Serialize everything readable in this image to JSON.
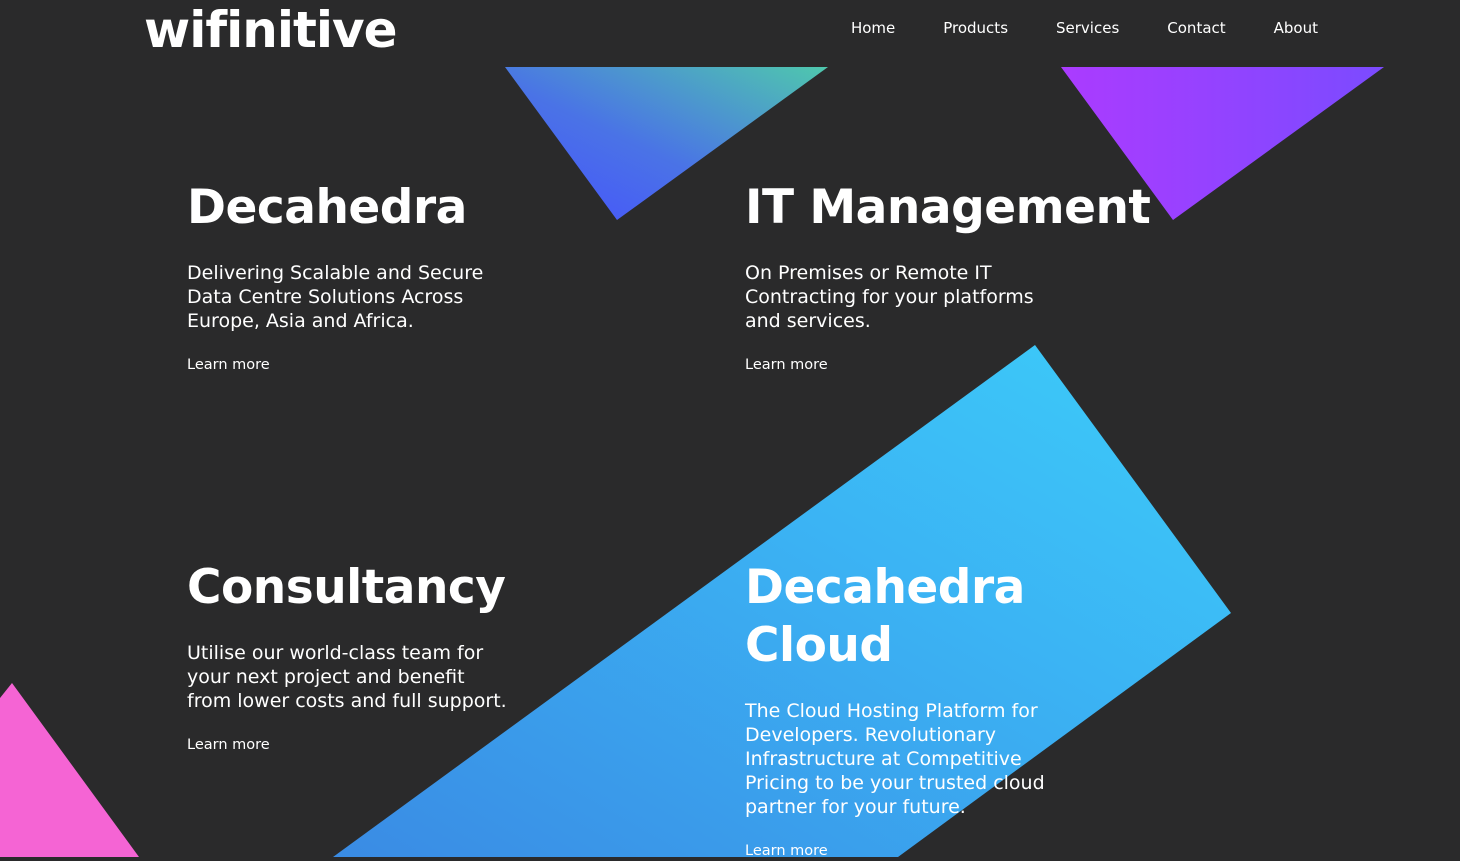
{
  "brand": {
    "logo_text": "wifinitive"
  },
  "nav": {
    "items": [
      {
        "label": "Home"
      },
      {
        "label": "Products"
      },
      {
        "label": "Services"
      },
      {
        "label": "Contact"
      },
      {
        "label": "About"
      }
    ]
  },
  "cards": [
    {
      "title": "Decahedra",
      "description": "Delivering Scalable and Secure Data Centre Solutions Across Europe, Asia and Africa.",
      "link_label": "Learn more"
    },
    {
      "title": "IT Management",
      "description": "On Premises or Remote IT Contracting for your platforms and services.",
      "link_label": "Learn more"
    },
    {
      "title": "Consultancy",
      "description": "Utilise our world-class team for your next project and benefit from lower costs and full support.",
      "link_label": "Learn more"
    },
    {
      "title": "Decahedra Cloud",
      "description": "The Cloud Hosting Platform for Developers. Revolutionary Infrastructure at Competitive Pricing to be your trusted cloud partner for your future.",
      "link_label": "Learn more"
    }
  ],
  "colors": {
    "background": "#2a2a2b",
    "text": "#ffffff",
    "triangle_blue_start": "#4a55ff",
    "triangle_blue_end": "#4dc8b0",
    "triangle_purple_start": "#a93cff",
    "triangle_purple_end": "#7a4cff",
    "cloud_shape_start": "#3a8ee6",
    "cloud_shape_end": "#3cc8f8",
    "pink_shape": "#f564d4"
  }
}
